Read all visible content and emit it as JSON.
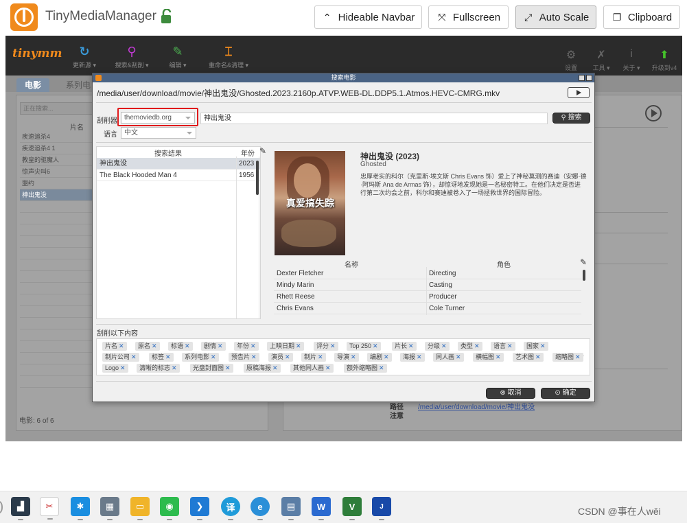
{
  "browser": {
    "app_title": "TinyMediaManager",
    "buttons": {
      "navbar": "Hideable Navbar",
      "fullscreen": "Fullscreen",
      "autoscale": "Auto Scale",
      "clipboard": "Clipboard"
    }
  },
  "app": {
    "logo_text": "tinymm",
    "toolbar": {
      "update": "更新源 ▾",
      "search": "搜索&刮削 ▾",
      "edit": "编辑 ▾",
      "rename": "重命名&清理 ▾",
      "settings": "设置",
      "tools": "工具 ▾",
      "about": "关于 ▾",
      "upgrade": "升级到v4"
    },
    "tabs": {
      "movies": "电影",
      "sets": "系列电"
    },
    "search_placeholder": "正在搜索...",
    "list_header": "片名",
    "movies": [
      "疾速追杀4",
      "疾速追杀4 1",
      "教皇的驱魔人",
      "惊声尖叫6",
      "盟约",
      "神出鬼没"
    ],
    "footer": "电影: 6 of 6",
    "detail_path_label": "路径",
    "detail_note_label": "注意",
    "detail_path_value": "/media/user/download/movie/神出鬼没"
  },
  "dialog": {
    "title": "搜索电影",
    "file_path": "/media/user/download/movie/神出鬼没/Ghosted.2023.2160p.ATVP.WEB-DL.DDP5.1.Atmos.HEVC-CMRG.mkv",
    "scraper_label": "刮削器",
    "scraper_value": "themoviedb.org",
    "language_label": "语言",
    "language_value": "中文",
    "query_value": "神出鬼没",
    "search_button": "搜索",
    "results_header_title": "搜索结果",
    "results_header_year": "年份",
    "results": [
      {
        "title": "神出鬼没",
        "year": "2023"
      },
      {
        "title": "The Black Hooded Man 4",
        "year": "1956"
      }
    ],
    "movie_title": "神出鬼没 (2023)",
    "movie_original": "Ghosted",
    "plot": "忠厚老实的科尔（克里斯·埃文斯 Chris Evans 饰）爱上了神秘莫测的赛迪（安娜·德·阿玛斯 Ana de Armas 饰），却惊讶地发现她是一名秘密特工。在他们决定是否进行第二次约会之前，科尔和赛迪被卷入了一场拯救世界的国际冒险。",
    "poster_title": "真爱搞失踪",
    "cast_header_name": "名称",
    "cast_header_role": "角色",
    "cast": [
      {
        "name": "Dexter Fletcher",
        "role": "Directing"
      },
      {
        "name": "Mindy Marin",
        "role": "Casting"
      },
      {
        "name": "Rhett Reese",
        "role": "Producer"
      },
      {
        "name": "Chris Evans",
        "role": "Cole Turner"
      }
    ],
    "scrape_section_label": "刮削以下内容",
    "chips_row1": [
      "片名",
      "原名",
      "标语",
      "剧情",
      "年份",
      "上映日期",
      "评分",
      "Top 250",
      "片长",
      "分级",
      "类型",
      "语言",
      "国家"
    ],
    "chips_row2": [
      "制片公司",
      "标签",
      "系列电影",
      "预告片",
      "演员",
      "制片",
      "导演",
      "编剧",
      "海报",
      "同人画",
      "横幅图",
      "艺术图",
      "缩略图"
    ],
    "chips_row3": [
      "Logo",
      "清晰的标志",
      "光盘封面图",
      "原稿海报",
      "其他同人画",
      "额外缩略图"
    ],
    "cancel_button": "取消",
    "ok_button": "确定"
  },
  "taskbar": {
    "items": [
      "app",
      "snip-tool",
      "alipay",
      "calculator",
      "file-explorer",
      "wechat",
      "vscode",
      "translator",
      "edge",
      "remote-desktop",
      "word",
      "vim",
      "jlink"
    ]
  },
  "watermark": "CSDN @事在人wěi"
}
